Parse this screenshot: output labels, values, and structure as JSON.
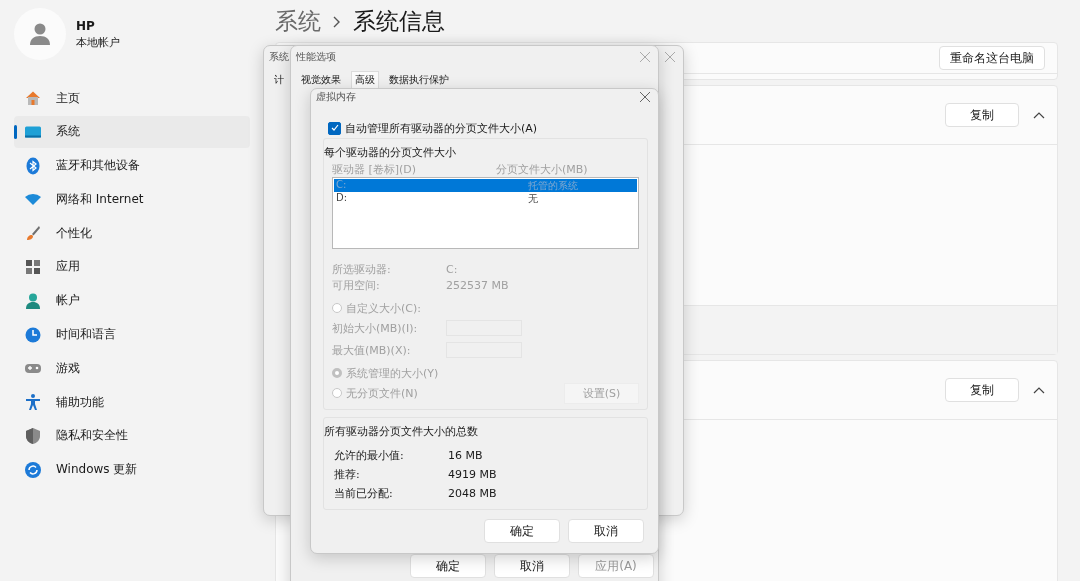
{
  "sidebar": {
    "user": {
      "name": "HP",
      "account": "本地帐户"
    },
    "items": [
      {
        "label": "主页",
        "selected": false
      },
      {
        "label": "系统",
        "selected": true
      },
      {
        "label": "蓝牙和其他设备",
        "selected": false
      },
      {
        "label": "网络和 Internet",
        "selected": false
      },
      {
        "label": "个性化",
        "selected": false
      },
      {
        "label": "应用",
        "selected": false
      },
      {
        "label": "帐户",
        "selected": false
      },
      {
        "label": "时间和语言",
        "selected": false
      },
      {
        "label": "游戏",
        "selected": false
      },
      {
        "label": "辅助功能",
        "selected": false
      },
      {
        "label": "隐私和安全性",
        "selected": false
      },
      {
        "label": "Windows 更新",
        "selected": false
      }
    ]
  },
  "breadcrumb": [
    "系统",
    "系统信息"
  ],
  "cards": [
    {
      "button": "重命名这台电脑"
    },
    {
      "button": "复制",
      "expanded": true
    },
    {
      "button": "复制",
      "expanded": true
    }
  ],
  "system_properties": {
    "title": "系统",
    "tab": "计"
  },
  "performance_options": {
    "title": "性能选项",
    "tabs": [
      {
        "label": "视觉效果",
        "selected": false
      },
      {
        "label": "高级",
        "selected": true
      },
      {
        "label": "数据执行保护",
        "selected": false
      }
    ],
    "buttons": [
      {
        "label": "确定",
        "disabled": false
      },
      {
        "label": "取消",
        "disabled": false
      },
      {
        "label": "应用(A)",
        "disabled": true
      }
    ]
  },
  "virtual_memory": {
    "title": "虚拟内存",
    "auto_manage": {
      "label": "自动管理所有驱动器的分页文件大小(A)",
      "checked": true
    },
    "group_title": "每个驱动器的分页文件大小",
    "columns": [
      "驱动器 [卷标](D)",
      "分页文件大小(MB)"
    ],
    "drives": [
      {
        "drive": "C:",
        "size": "托管的系统",
        "selected": true
      },
      {
        "drive": "D:",
        "size": "无",
        "selected": false
      }
    ],
    "selected_drive": {
      "label": "所选驱动器:",
      "value": "C:"
    },
    "free_space": {
      "label": "可用空间:",
      "value": "252537 MB"
    },
    "custom": {
      "label": "自定义大小(C):",
      "selected": false
    },
    "initial_size": "初始大小(MB)(I):",
    "max_size": "最大值(MB)(X):",
    "system_managed": {
      "label": "系统管理的大小(Y)",
      "selected": true
    },
    "no_paging": {
      "label": "无分页文件(N)",
      "selected": false
    },
    "set_button": "设置(S)",
    "totals": {
      "title": "所有驱动器分页文件大小的总数",
      "rows": [
        {
          "label": "允许的最小值:",
          "value": "16 MB"
        },
        {
          "label": "推荐:",
          "value": "4919 MB"
        },
        {
          "label": "当前已分配:",
          "value": "2048 MB"
        }
      ]
    },
    "buttons": [
      "确定",
      "取消"
    ]
  }
}
